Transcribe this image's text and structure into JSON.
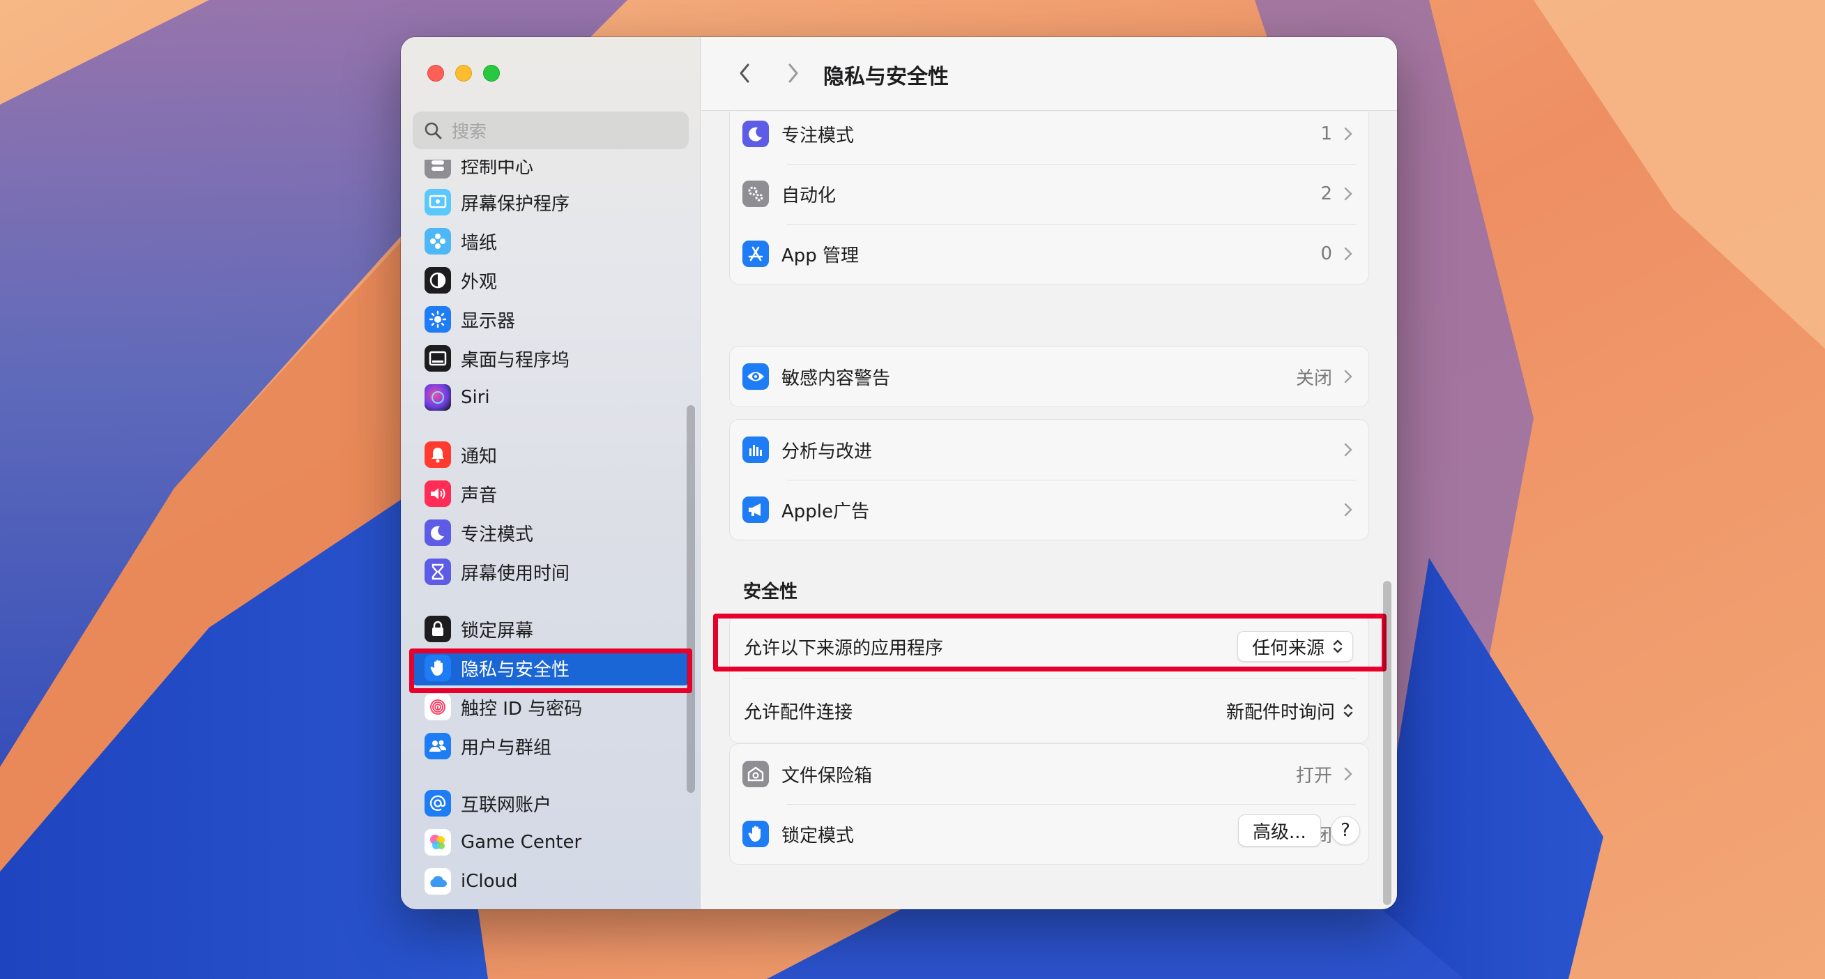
{
  "window": {
    "title": "隐私与安全性"
  },
  "search": {
    "placeholder": "搜索"
  },
  "sidebar": {
    "items": [
      {
        "label": "控制中心",
        "icon": "control-center-icon"
      },
      {
        "label": "屏幕保护程序",
        "icon": "screensaver-icon"
      },
      {
        "label": "墙纸",
        "icon": "wallpaper-icon"
      },
      {
        "label": "外观",
        "icon": "appearance-icon"
      },
      {
        "label": "显示器",
        "icon": "display-icon"
      },
      {
        "label": "桌面与程序坞",
        "icon": "dock-icon"
      },
      {
        "label": "Siri",
        "icon": "siri-icon"
      },
      {
        "label": "通知",
        "icon": "notifications-icon"
      },
      {
        "label": "声音",
        "icon": "sound-icon"
      },
      {
        "label": "专注模式",
        "icon": "focus-icon"
      },
      {
        "label": "屏幕使用时间",
        "icon": "screen-time-icon"
      },
      {
        "label": "锁定屏幕",
        "icon": "lock-icon"
      },
      {
        "label": "隐私与安全性",
        "icon": "hand-icon",
        "selected": true
      },
      {
        "label": "触控 ID 与密码",
        "icon": "fingerprint-icon"
      },
      {
        "label": "用户与群组",
        "icon": "users-icon"
      },
      {
        "label": "互联网账户",
        "icon": "at-icon"
      },
      {
        "label": "Game Center",
        "icon": "game-center-icon"
      },
      {
        "label": "iCloud",
        "icon": "icloud-icon"
      }
    ]
  },
  "privacy_rows": [
    {
      "label": "专注模式",
      "value": "1",
      "icon": "focus-icon"
    },
    {
      "label": "自动化",
      "value": "2",
      "icon": "gear-icon"
    },
    {
      "label": "App 管理",
      "value": "0",
      "icon": "app-store-icon"
    }
  ],
  "sensitive": {
    "label": "敏感内容警告",
    "value": "关闭",
    "icon": "eye-icon"
  },
  "analytics_rows": [
    {
      "label": "分析与改进",
      "value": "",
      "icon": "chart-icon"
    },
    {
      "label": "Apple广告",
      "value": "",
      "icon": "megaphone-icon"
    }
  ],
  "security": {
    "title": "安全性",
    "allow_apps": {
      "label": "允许以下来源的应用程序",
      "value": "任何来源"
    },
    "accessories": {
      "label": "允许配件连接",
      "value": "新配件时询问"
    }
  },
  "bottom_rows": [
    {
      "label": "文件保险箱",
      "value": "打开",
      "icon": "vault-icon"
    },
    {
      "label": "锁定模式",
      "value": "关闭",
      "icon": "hand-icon"
    }
  ],
  "buttons": {
    "advanced": "高级...",
    "help": "?"
  },
  "colors": {
    "accent": "#1a66d6",
    "highlight": "#e6002a"
  }
}
